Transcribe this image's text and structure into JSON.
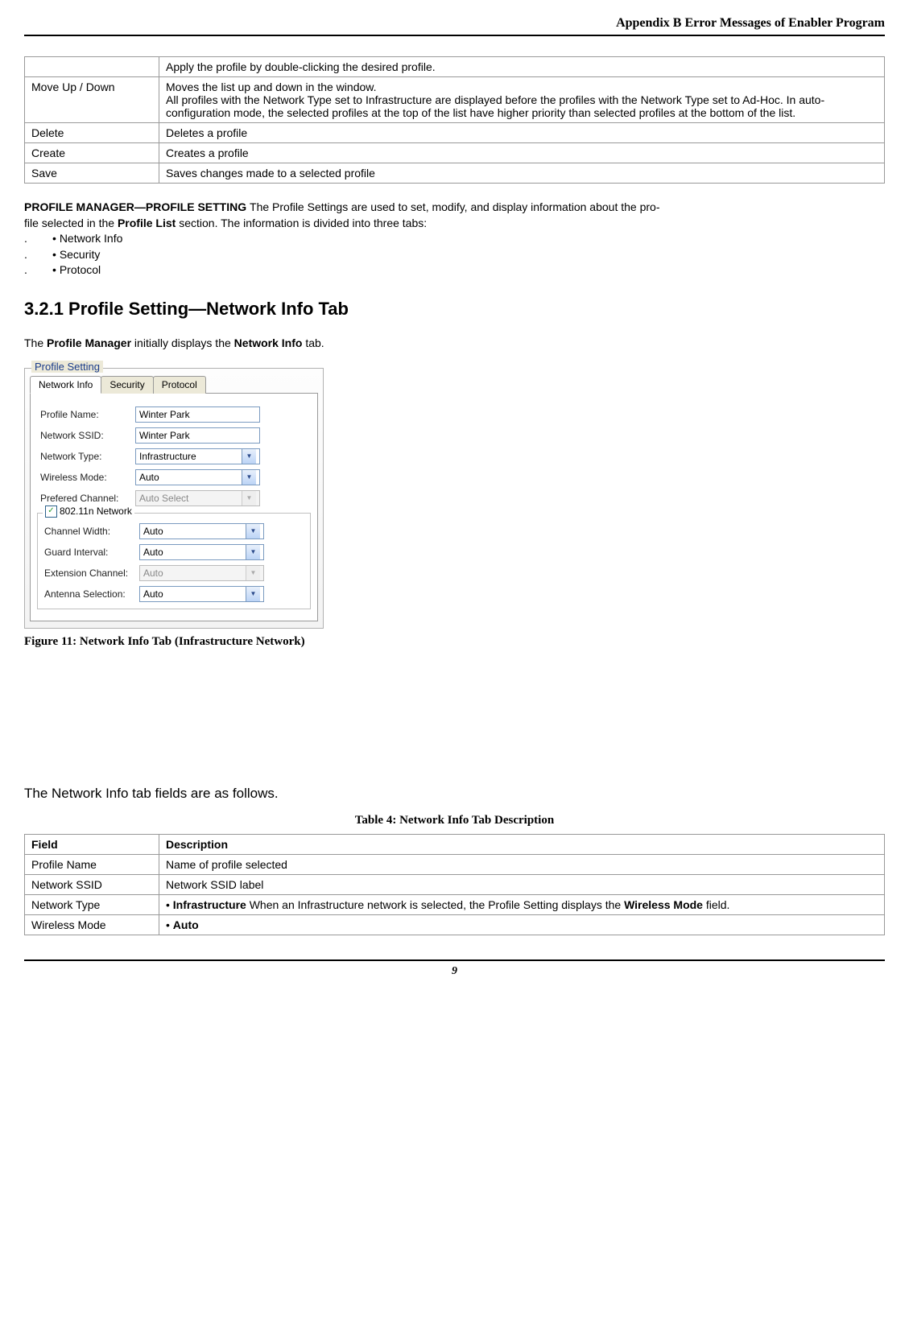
{
  "header": {
    "title": "Appendix B Error Messages of Enabler Program"
  },
  "table1": {
    "rows": [
      {
        "c1": "",
        "c2": "Apply the profile by double-clicking the desired profile."
      },
      {
        "c1": "Move Up / Down",
        "c2": "Moves the list up and down in the window.",
        "c2b": "All profiles with the Network Type set to Infrastructure are displayed before the profiles with the Network Type set to Ad-Hoc. In auto-configuration mode, the selected profiles at the top of the list have higher priority than selected profiles at the bottom of the list."
      },
      {
        "c1": "Delete",
        "c2": "Deletes a profile"
      },
      {
        "c1": "Create",
        "c2": "Creates a profile"
      },
      {
        "c1": "Save",
        "c2": "Saves changes made to a selected profile"
      }
    ]
  },
  "profileManager": {
    "lead_bold": "PROFILE MANAGER—PROFILE SETTING ",
    "lead": "The Profile Settings are used to set, modify, and display information about the pro",
    "lead2": "file selected in the ",
    "lead2b": "Profile List",
    "lead2c": " section. The information is divided into three tabs:",
    "bullets": [
      "Network Info",
      "Security",
      "Protocol"
    ]
  },
  "section": {
    "heading": "3.2.1 Profile Setting—Network Info Tab",
    "intro1": "The ",
    "intro2": "Profile Manager",
    "intro3": " initially displays the ",
    "intro4": "Network Info",
    "intro5": " tab."
  },
  "figure": {
    "groupbox_title": "Profile Setting",
    "tabs": {
      "network": "Network Info",
      "security": "Security",
      "protocol": "Protocol"
    },
    "fields": {
      "profile_name": {
        "label": "Profile Name:",
        "value": "Winter Park"
      },
      "network_ssid": {
        "label": "Network SSID:",
        "value": "Winter Park"
      },
      "network_type": {
        "label": "Network Type:",
        "value": "Infrastructure"
      },
      "wireless_mode": {
        "label": "Wireless Mode:",
        "value": "Auto"
      },
      "prefered_channel": {
        "label": "Prefered Channel:",
        "value": "Auto Select"
      },
      "group_label": "802.11n Network",
      "channel_width": {
        "label": "Channel Width:",
        "value": "Auto"
      },
      "guard_interval": {
        "label": "Guard Interval:",
        "value": "Auto"
      },
      "extension_channel": {
        "label": "Extension Channel:",
        "value": "Auto"
      },
      "antenna_selection": {
        "label": "Antenna Selection:",
        "value": "Auto"
      }
    },
    "caption_label": "Figure 11: ",
    "caption_text": "Network Info Tab (Infrastructure Network)"
  },
  "subtext": "The Network Info tab fields are as follows.",
  "table4": {
    "caption": "Table 4: Network Info Tab Description",
    "headers": {
      "field": "Field",
      "desc": "Description"
    },
    "rows": [
      {
        "c1": "Profile Name",
        "c2": "Name of profile selected"
      },
      {
        "c1": "Network SSID",
        "c2": "Network SSID label"
      },
      {
        "c1": "Network Type",
        "c2": "• ",
        "c2bold": "Infrastructure ",
        "c2rest": "When an Infrastructure network is selected, the Profile Setting displays the ",
        "c2bold2": "Wireless Mode",
        "c2rest2": " field."
      },
      {
        "c1": "Wireless Mode",
        "c2": "• ",
        "c2bold": "Auto"
      }
    ]
  },
  "page_number": "9"
}
